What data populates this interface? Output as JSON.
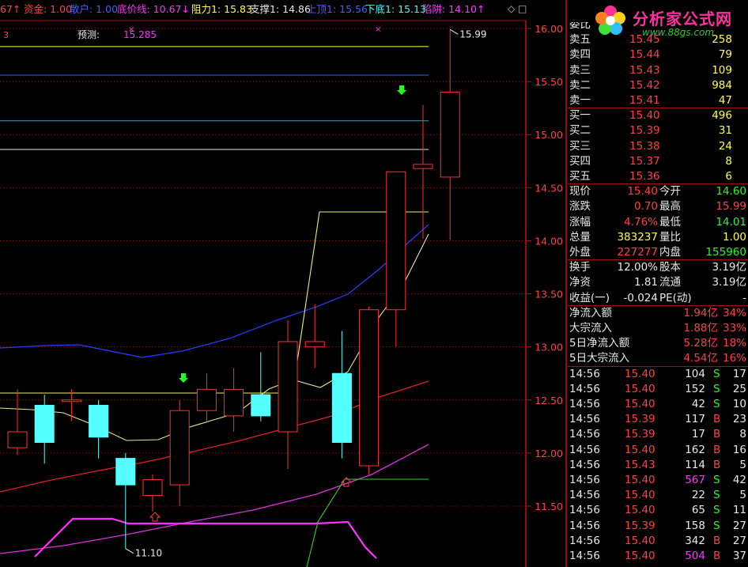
{
  "header": {
    "items": [
      {
        "text": "67↑",
        "color": "#ff4040"
      },
      {
        "text": "资金: 1.00",
        "color": "#ff4040"
      },
      {
        "text": "散户: 1.00",
        "color": "#4060ff"
      },
      {
        "text": "底价线: 10.67↓",
        "color": "#ff30ff"
      },
      {
        "text": "阻力1: 15.83",
        "color": "#ffff44"
      },
      {
        "text": "支撑1: 14.86",
        "color": "#e8e8e8"
      },
      {
        "text": "上顶1: 15.56",
        "color": "#4060ff"
      },
      {
        "text": "下底1: 15.13",
        "color": "#40ffff"
      },
      {
        "text": "陷阱: 14.10↑",
        "color": "#ff30ff"
      }
    ],
    "sub_left": "3",
    "forecast_label": "预测:",
    "forecast_value": "15.285",
    "corner_glyphs": "◇ □"
  },
  "logo": {
    "brand": "分析家公式网",
    "url": "www.88gs.com"
  },
  "chart_data": {
    "type": "candlestick",
    "y_ticks": [
      "16.00",
      "15.50",
      "15.00",
      "14.50",
      "14.00",
      "13.50",
      "13.00",
      "12.50",
      "12.00",
      "11.50"
    ],
    "ylim": [
      11.23,
      16.28
    ],
    "grid": "horizontal dotted",
    "candles": [
      {
        "o": 12.05,
        "h": 12.6,
        "l": 11.98,
        "c": 12.2
      },
      {
        "o": 12.45,
        "h": 12.55,
        "l": 11.9,
        "c": 12.1
      },
      {
        "o": 12.5,
        "h": 12.6,
        "l": 12.3,
        "c": 12.5
      },
      {
        "o": 12.45,
        "h": 12.5,
        "l": 11.95,
        "c": 12.15
      },
      {
        "o": 11.95,
        "h": 12.0,
        "l": 11.1,
        "c": 11.7
      },
      {
        "o": 11.6,
        "h": 11.8,
        "l": 11.45,
        "c": 11.75
      },
      {
        "o": 11.7,
        "h": 12.5,
        "l": 11.5,
        "c": 12.4
      },
      {
        "o": 12.4,
        "h": 12.75,
        "l": 12.3,
        "c": 12.6
      },
      {
        "o": 12.35,
        "h": 12.8,
        "l": 12.2,
        "c": 12.6
      },
      {
        "o": 12.55,
        "h": 12.95,
        "l": 12.3,
        "c": 12.35
      },
      {
        "o": 12.2,
        "h": 13.25,
        "l": 11.85,
        "c": 13.05
      },
      {
        "o": 13.0,
        "h": 13.4,
        "l": 12.8,
        "c": 13.05
      },
      {
        "o": 12.75,
        "h": 13.15,
        "l": 11.95,
        "c": 12.1
      },
      {
        "o": 11.88,
        "h": 13.38,
        "l": 11.8,
        "c": 13.35
      },
      {
        "o": 13.35,
        "h": 14.65,
        "l": 13.0,
        "c": 14.65
      },
      {
        "o": 14.68,
        "h": 15.28,
        "l": 14.02,
        "c": 14.72
      },
      {
        "o": 14.6,
        "h": 15.99,
        "l": 14.01,
        "c": 15.4
      }
    ],
    "horizontal_lines": [
      {
        "value": 15.83,
        "color": "#ffff44"
      },
      {
        "value": 15.56,
        "color": "#4060ff"
      },
      {
        "value": 15.13,
        "color": "#40a0c0"
      },
      {
        "value": 14.86,
        "color": "#e8e8e8"
      }
    ],
    "annotations": {
      "high_label": "15.99",
      "low_label": "11.10"
    }
  },
  "quote": {
    "top_label": "委比",
    "sell": [
      {
        "label": "卖五",
        "price": "15.45",
        "vol": "258"
      },
      {
        "label": "卖四",
        "price": "15.44",
        "vol": "79"
      },
      {
        "label": "卖三",
        "price": "15.43",
        "vol": "109"
      },
      {
        "label": "卖二",
        "price": "15.42",
        "vol": "984"
      },
      {
        "label": "卖一",
        "price": "15.41",
        "vol": "47"
      }
    ],
    "buy": [
      {
        "label": "买一",
        "price": "15.40",
        "vol": "496"
      },
      {
        "label": "买二",
        "price": "15.39",
        "vol": "31"
      },
      {
        "label": "买三",
        "price": "15.38",
        "vol": "24"
      },
      {
        "label": "买四",
        "price": "15.37",
        "vol": "8"
      },
      {
        "label": "买五",
        "price": "15.36",
        "vol": "6"
      }
    ],
    "stats1": [
      {
        "l1": "现价",
        "v1": "15.40",
        "c1": "r",
        "l2": "今开",
        "v2": "14.60",
        "c2": "g"
      },
      {
        "l1": "涨跌",
        "v1": "0.70",
        "c1": "r",
        "l2": "最高",
        "v2": "15.99",
        "c2": "r"
      },
      {
        "l1": "涨幅",
        "v1": "4.76%",
        "c1": "r",
        "l2": "最低",
        "v2": "14.01",
        "c2": "g"
      },
      {
        "l1": "总量",
        "v1": "383237",
        "c1": "y",
        "l2": "量比",
        "v2": "1.00",
        "c2": "y"
      },
      {
        "l1": "外盘",
        "v1": "227277",
        "c1": "r",
        "l2": "内盘",
        "v2": "155960",
        "c2": "g"
      }
    ],
    "stats2": [
      {
        "l1": "换手",
        "v1": "12.00%",
        "l2": "股本",
        "v2": "3.19亿"
      },
      {
        "l1": "净资",
        "v1": "1.81",
        "l2": "流通",
        "v2": "3.19亿"
      },
      {
        "l1": "收益(一)",
        "v1": "-0.024",
        "l2": "PE(动)",
        "v2": "-"
      }
    ],
    "flows": [
      {
        "label": "净流入额",
        "value": "1.94亿",
        "pct": "34%"
      },
      {
        "label": "大宗流入",
        "value": "1.88亿",
        "pct": "33%"
      },
      {
        "label": "5日净流入额",
        "value": "5.28亿",
        "pct": "18%"
      },
      {
        "label": "5日大宗流入",
        "value": "4.54亿",
        "pct": "16%"
      }
    ],
    "ticks": [
      {
        "time": "14:56",
        "price": "15.40",
        "vol": "104",
        "vc": "w",
        "bs": "S",
        "n": "17"
      },
      {
        "time": "14:56",
        "price": "15.40",
        "vol": "152",
        "vc": "w",
        "bs": "S",
        "n": "25"
      },
      {
        "time": "14:56",
        "price": "15.40",
        "vol": "42",
        "vc": "w",
        "bs": "S",
        "n": "10"
      },
      {
        "time": "14:56",
        "price": "15.39",
        "vol": "117",
        "vc": "w",
        "bs": "B",
        "n": "23"
      },
      {
        "time": "14:56",
        "price": "15.39",
        "vol": "17",
        "vc": "w",
        "bs": "B",
        "n": "8"
      },
      {
        "time": "14:56",
        "price": "15.40",
        "vol": "162",
        "vc": "w",
        "bs": "B",
        "n": "16"
      },
      {
        "time": "14:56",
        "price": "15.43",
        "vol": "114",
        "vc": "w",
        "bs": "B",
        "n": "5"
      },
      {
        "time": "14:56",
        "price": "15.40",
        "vol": "567",
        "vc": "m",
        "bs": "S",
        "n": "42"
      },
      {
        "time": "14:56",
        "price": "15.40",
        "vol": "22",
        "vc": "w",
        "bs": "S",
        "n": "5"
      },
      {
        "time": "14:56",
        "price": "15.40",
        "vol": "65",
        "vc": "w",
        "bs": "S",
        "n": "11"
      },
      {
        "time": "14:56",
        "price": "15.39",
        "vol": "158",
        "vc": "w",
        "bs": "S",
        "n": "27"
      },
      {
        "time": "14:56",
        "price": "15.40",
        "vol": "342",
        "vc": "w",
        "bs": "B",
        "n": "27"
      },
      {
        "time": "14:56",
        "price": "15.40",
        "vol": "504",
        "vc": "m",
        "bs": "B",
        "n": "37"
      }
    ]
  }
}
